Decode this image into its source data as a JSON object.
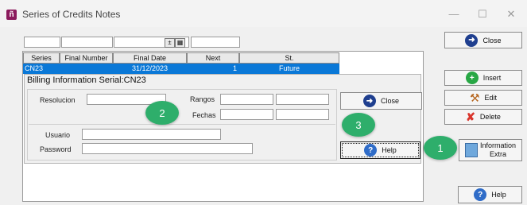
{
  "window": {
    "title": "Series of Credits Notes",
    "icon_letter": "ñ"
  },
  "controls": {
    "minimize": "—",
    "maximize": "☐",
    "close": "✕"
  },
  "grid": {
    "columns": [
      "Series",
      "Final Number",
      "Final Date",
      "Next",
      "St."
    ],
    "row": {
      "series": "CN23",
      "final_number": "",
      "final_date": "31/12/2023",
      "next": "1",
      "st": "Future"
    }
  },
  "billing": {
    "title": "Billing Information Serial:CN23",
    "resolucion_label": "Resolucion",
    "rangos_label": "Rangos",
    "fechas_label": "Fechas",
    "usuario_label": "Usuario",
    "password_label": "Password",
    "close_label": "Close",
    "help_label": "Help"
  },
  "sidebar": {
    "close_label": "Close",
    "insert_label": "Insert",
    "edit_label": "Edit",
    "delete_label": "Delete",
    "info_label_1": "Information",
    "info_label_2": "Extra",
    "help_label": "Help"
  },
  "badges": {
    "one": "1",
    "two": "2",
    "three": "3"
  },
  "colors": {
    "selection": "#0a78d7",
    "badge": "#2eae6b",
    "nav_icon": "#1f3f8f",
    "help_icon": "#2f6cc8",
    "insert_icon": "#28a745",
    "delete_icon": "#d9342b"
  }
}
